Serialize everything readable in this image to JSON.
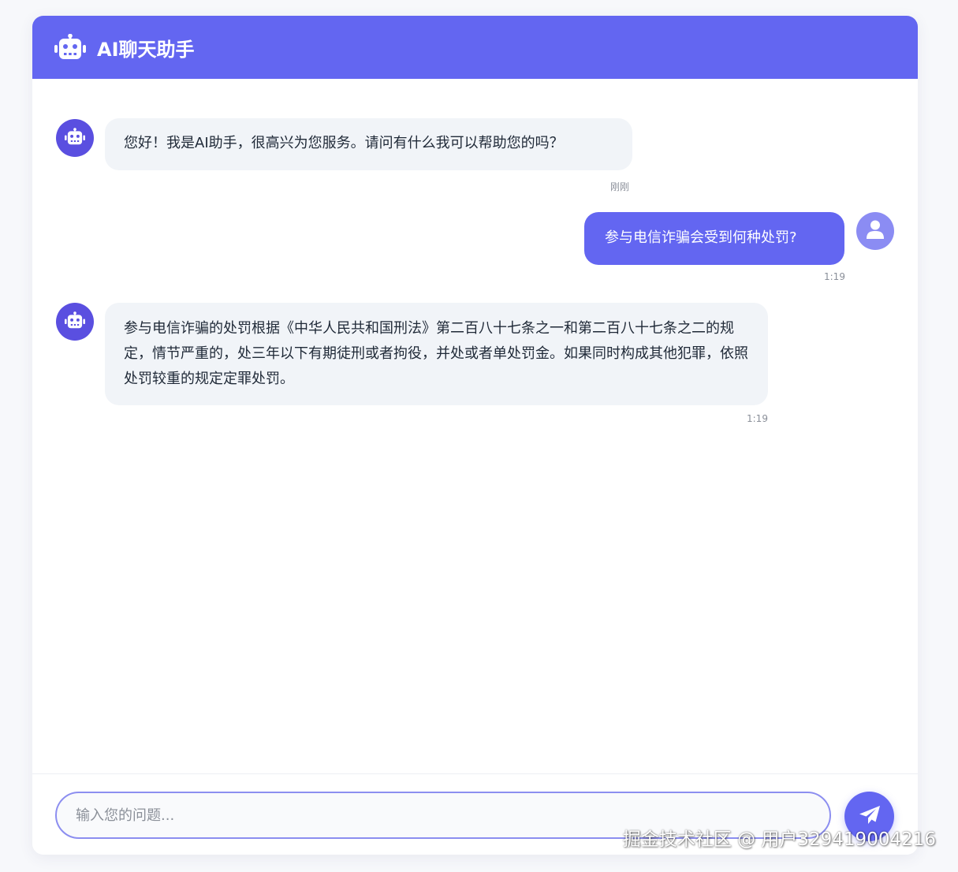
{
  "header": {
    "title": "AI聊天助手",
    "icon": "robot-icon"
  },
  "messages": [
    {
      "role": "bot",
      "text": "您好！我是AI助手，很高兴为您服务。请问有什么我可以帮助您的吗？",
      "time": "刚刚"
    },
    {
      "role": "user",
      "text": "参与电信诈骗会受到何种处罚?",
      "time": "1:19"
    },
    {
      "role": "bot",
      "text": "参与电信诈骗的处罚根据《中华人民共和国刑法》第二百八十七条之一和第二百八十七条之二的规定，情节严重的，处三年以下有期徒刑或者拘役，并处或者单处罚金。如果同时构成其他犯罪，依照处罚较重的规定定罪处罚。",
      "time": "1:19"
    }
  ],
  "input": {
    "placeholder": "输入您的问题...",
    "value": ""
  },
  "send": {
    "icon": "paper-plane-icon"
  },
  "watermark": "掘金技术社区 @ 用户329419004216",
  "colors": {
    "accent": "#6366f1",
    "bot_avatar": "#5a4fe0",
    "user_avatar": "#8b8cf3",
    "bot_bubble": "#f1f4f8"
  }
}
